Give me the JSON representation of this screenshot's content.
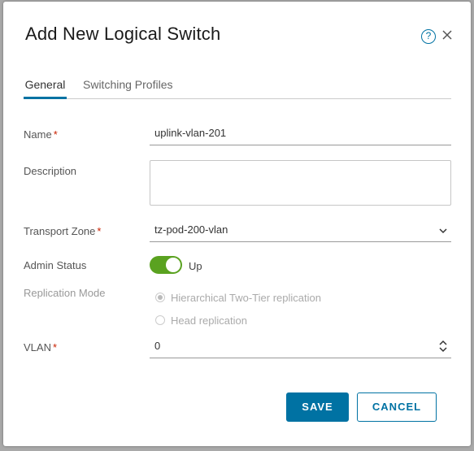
{
  "dialog": {
    "title": "Add New Logical Switch",
    "help_icon": "help-circle-icon",
    "close_icon": "close-icon"
  },
  "tabs": [
    {
      "label": "General",
      "active": true
    },
    {
      "label": "Switching Profiles",
      "active": false
    }
  ],
  "form": {
    "name": {
      "label": "Name",
      "required": "*",
      "value": "uplink-vlan-201"
    },
    "description": {
      "label": "Description",
      "value": ""
    },
    "transport_zone": {
      "label": "Transport Zone",
      "required": "*",
      "value": "tz-pod-200-vlan"
    },
    "admin_status": {
      "label": "Admin Status",
      "value": "Up",
      "enabled": true
    },
    "replication_mode": {
      "label": "Replication Mode",
      "options": [
        {
          "label": "Hierarchical Two-Tier replication",
          "checked": true
        },
        {
          "label": "Head replication",
          "checked": false
        }
      ]
    },
    "vlan": {
      "label": "VLAN",
      "required": "*",
      "value": "0"
    }
  },
  "buttons": {
    "save": "SAVE",
    "cancel": "CANCEL"
  },
  "colors": {
    "accent": "#0072a3",
    "toggle_on": "#5aa220",
    "required": "#c92100"
  }
}
